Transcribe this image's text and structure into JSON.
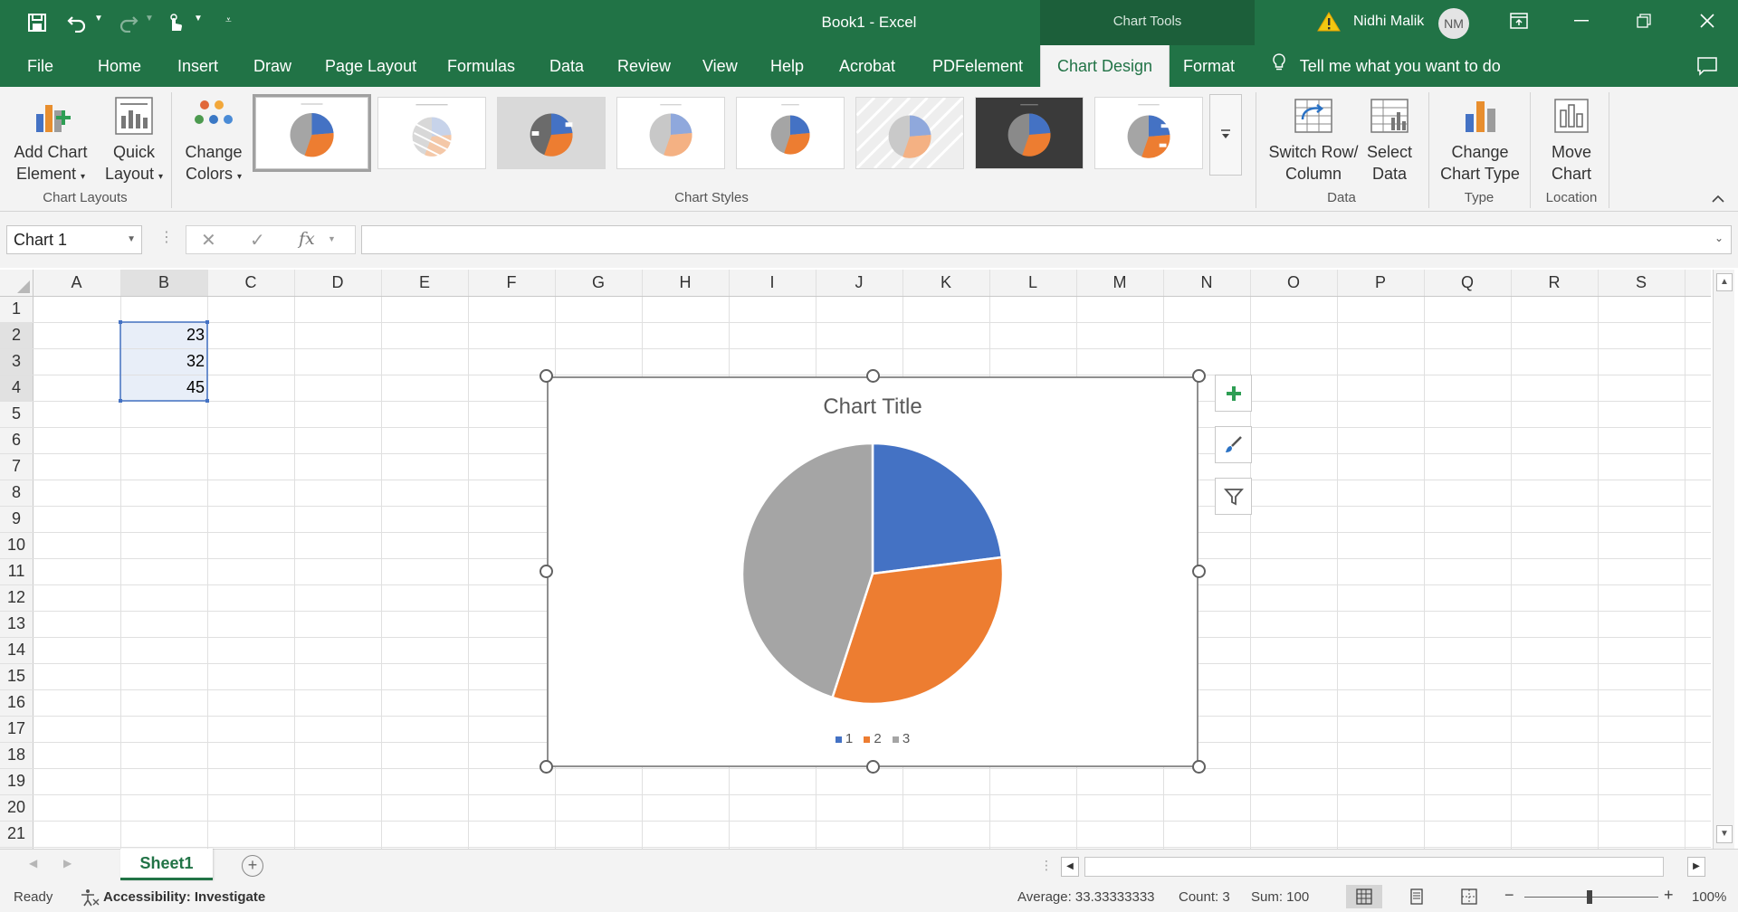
{
  "window": {
    "doc_title": "Book1  -  Excel",
    "context_label": "Chart Tools",
    "user_name": "Nidhi Malik",
    "user_initials": "NM"
  },
  "tabs": [
    {
      "label": "File"
    },
    {
      "label": "Home"
    },
    {
      "label": "Insert"
    },
    {
      "label": "Draw"
    },
    {
      "label": "Page Layout"
    },
    {
      "label": "Formulas"
    },
    {
      "label": "Data"
    },
    {
      "label": "Review"
    },
    {
      "label": "View"
    },
    {
      "label": "Help"
    },
    {
      "label": "Acrobat"
    },
    {
      "label": "PDFelement"
    },
    {
      "label": "Chart Design"
    },
    {
      "label": "Format"
    }
  ],
  "tell_me": "Tell me what you want to do",
  "ribbon": {
    "add_chart_element": [
      "Add Chart",
      "Element"
    ],
    "quick_layout": [
      "Quick",
      "Layout"
    ],
    "change_colors": [
      "Change",
      "Colors"
    ],
    "chart_layouts_group": "Chart Layouts",
    "chart_styles_group": "Chart Styles",
    "switch_row_column": [
      "Switch Row/",
      "Column"
    ],
    "select_data": [
      "Select",
      "Data"
    ],
    "data_group": "Data",
    "change_chart_type": [
      "Change",
      "Chart Type"
    ],
    "type_group": "Type",
    "move_chart": [
      "Move",
      "Chart"
    ],
    "location_group": "Location"
  },
  "formula_bar": {
    "name_box": "Chart 1",
    "fx": "fx",
    "formula": ""
  },
  "sheet": {
    "columns": [
      "A",
      "B",
      "C",
      "D",
      "E",
      "F",
      "G",
      "H",
      "I",
      "J",
      "K",
      "L",
      "M",
      "N",
      "O",
      "P",
      "Q",
      "R",
      "S"
    ],
    "rows": [
      "1",
      "2",
      "3",
      "4",
      "5",
      "6",
      "7",
      "8",
      "9",
      "10",
      "11",
      "12",
      "13",
      "14",
      "15",
      "16",
      "17",
      "18",
      "19",
      "20",
      "21"
    ],
    "cells": {
      "B2": "23",
      "B3": "32",
      "B4": "45"
    },
    "tab_name": "Sheet1"
  },
  "chart_data": {
    "type": "pie",
    "title": "Chart Title",
    "categories": [
      "1",
      "2",
      "3"
    ],
    "values": [
      23,
      32,
      45
    ],
    "colors": [
      "#4472c4",
      "#ed7d31",
      "#a5a5a5"
    ],
    "legend": "bottom"
  },
  "status": {
    "ready": "Ready",
    "accessibility": "Accessibility: Investigate",
    "average": "Average: 33.33333333",
    "count": "Count: 3",
    "sum": "Sum: 100",
    "zoom": "100%"
  },
  "icons": {
    "save": "save-icon",
    "undo": "undo-icon",
    "redo": "redo-icon",
    "touch": "touch-mode-icon",
    "warning": "warning-icon",
    "lightbulb": "lightbulb-icon"
  }
}
